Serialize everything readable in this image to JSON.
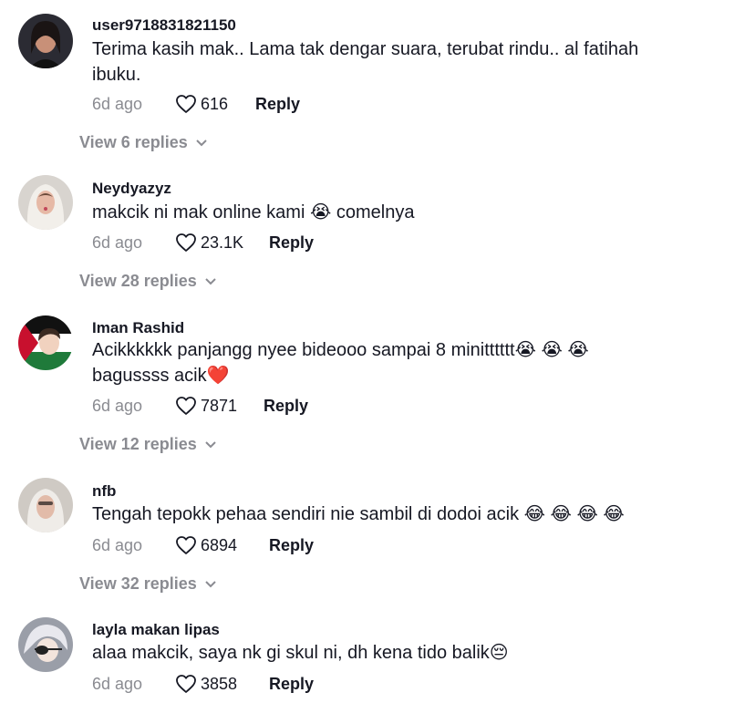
{
  "comments": [
    {
      "username": "user9718831821150",
      "text": "Terima kasih mak.. Lama tak dengar suara, terubat rindu.. al fatihah ibuku.",
      "time": "6d ago",
      "likes": "616",
      "reply": "Reply",
      "view_replies": "View 6 replies"
    },
    {
      "username": "Neydyazyz",
      "text": "makcik ni mak online kami 😭 comelnya",
      "time": "6d ago",
      "likes": "23.1K",
      "reply": "Reply",
      "view_replies": "View 28 replies"
    },
    {
      "username": "Iman Rashid",
      "text": "Acikkkkkk panjangg nyee bideooo sampai 8 minitttttt😭 😭 😭 bagussss acik❤️",
      "time": "6d ago",
      "likes": "7871",
      "reply": "Reply",
      "view_replies": "View 12 replies"
    },
    {
      "username": "nfb",
      "text": "Tengah tepokk pehaa sendiri nie sambil di dodoi acik 😂 😂 😂 😂",
      "time": "6d ago",
      "likes": "6894",
      "reply": "Reply",
      "view_replies": "View 32 replies"
    },
    {
      "username": "layla makan lipas",
      "text": "alaa makcik, saya nk gi skul ni, dh kena tido balik😔",
      "time": "6d ago",
      "likes": "3858",
      "reply": "Reply"
    }
  ],
  "icons": {
    "like": "heart-outline-icon",
    "expand": "chevron-down-icon"
  },
  "colors": {
    "text": "#161823",
    "muted": "#8a8b91"
  }
}
